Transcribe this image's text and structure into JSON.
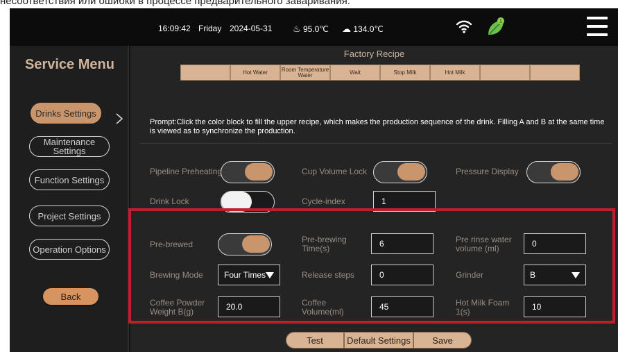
{
  "caption": "несоответствия или ошибки в процессе предварительного заваривания.",
  "status": {
    "time": "16:09:42",
    "day": "Friday",
    "date": "2024-05-31",
    "temp1": "95.0℃",
    "temp2": "134.0℃",
    "leaf_badge": "1"
  },
  "sidebar": {
    "title": "Service Menu",
    "items": [
      {
        "label": "Drinks Settings",
        "active": true
      },
      {
        "label": "Maintenance Settings"
      },
      {
        "label": "Function Settings"
      },
      {
        "label": "Project Settings"
      },
      {
        "label": "Operation Options"
      }
    ],
    "back_label": "Back"
  },
  "recipe": {
    "title": "Factory Recipe",
    "cells": [
      "",
      "Hot Water",
      "Room Temperature Water",
      "Wait",
      "Stop Milk",
      "Hot Milk",
      "",
      ""
    ]
  },
  "prompt": "Prompt:Click the color block to fill the upper recipe, which makes the production sequence of the drink. Filling A and B at the same time is viewed as to synchronize the production.",
  "toggles": {
    "pipeline_preheating": {
      "label": "Pipeline Preheating",
      "on": true
    },
    "cup_volume_lock": {
      "label": "Cup Volume Lock",
      "on": true
    },
    "pressure_display": {
      "label": "Pressure Display",
      "on": true
    },
    "drink_lock": {
      "label": "Drink Lock",
      "on": false
    }
  },
  "cycle_index": {
    "label": "Cycle-index",
    "value": "1"
  },
  "settings": {
    "pre_brewed": {
      "label": "Pre-brewed",
      "on": true
    },
    "pre_brewing_time": {
      "label": "Pre-brewing Time(s)",
      "value": "6"
    },
    "pre_rinse_water": {
      "label": "Pre rinse water volume (ml)",
      "value": "0"
    },
    "brewing_mode": {
      "label": "Brewing Mode",
      "value": "Four Times"
    },
    "release_steps": {
      "label": "Release steps",
      "value": "0"
    },
    "grinder": {
      "label": "Grinder",
      "value": "B"
    },
    "coffee_powder_weight": {
      "label": "Coffee Powder Weight B(g)",
      "value": "20.0"
    },
    "coffee_volume": {
      "label": "Coffee Volume(ml)",
      "value": "45"
    },
    "hot_milk_foam": {
      "label": "Hot Milk Foam 1(s)",
      "value": "10"
    }
  },
  "actions": {
    "test": "Test",
    "default_settings": "Default Settings",
    "save": "Save"
  },
  "colors": {
    "accent": "#c8956c",
    "highlight_border": "#c0202c",
    "recipe_cell": "#d9b494"
  }
}
